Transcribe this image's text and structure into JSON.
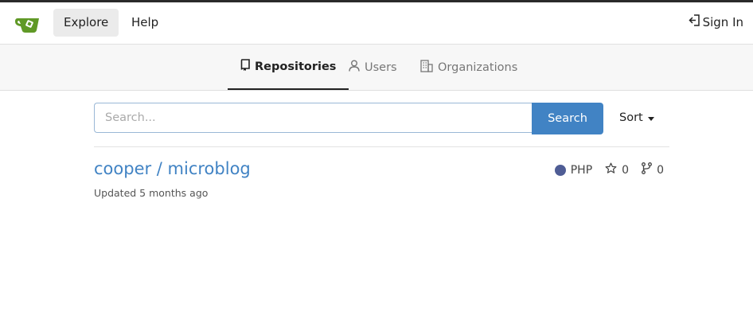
{
  "colors": {
    "accent": "#4183c4",
    "brand": "#609926",
    "php_lang": "#4F5D95"
  },
  "nav": {
    "logo_icon": "gitea-teacup-icon",
    "explore_label": "Explore",
    "help_label": "Help",
    "signin_label": "Sign In",
    "signin_icon": "sign-in-icon"
  },
  "tabs": [
    {
      "label": "Repositories",
      "icon": "repo-icon",
      "active": true
    },
    {
      "label": "Users",
      "icon": "person-icon",
      "active": false
    },
    {
      "label": "Organizations",
      "icon": "organization-icon",
      "active": false
    }
  ],
  "search": {
    "placeholder": "Search...",
    "button_label": "Search"
  },
  "sort": {
    "label": "Sort"
  },
  "repos": [
    {
      "full_name": "cooper / microblog",
      "updated": "Updated 5 months ago",
      "language": "PHP",
      "stars": "0",
      "forks": "0"
    }
  ]
}
